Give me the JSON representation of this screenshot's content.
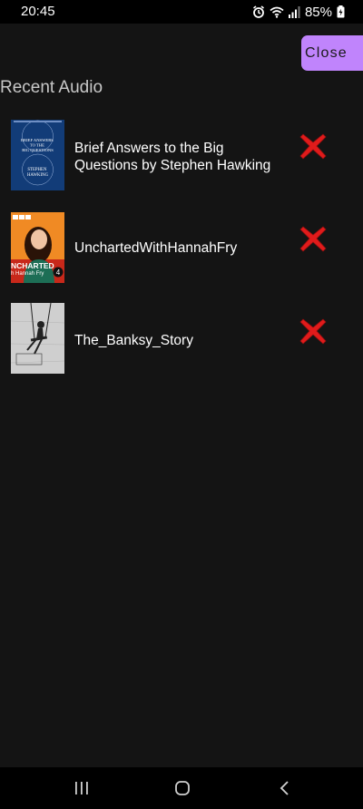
{
  "status_bar": {
    "time": "20:45",
    "battery_percent": "85%",
    "icons": [
      "alarm-icon",
      "wifi-icon",
      "signal-icon",
      "battery-charging-icon"
    ]
  },
  "close_label": "Close",
  "section_title": "Recent Audio",
  "colors": {
    "background": "#141414",
    "close_button": "#c084fc",
    "delete_icon": "#e01b1b"
  },
  "items": [
    {
      "title": "Brief Answers to the Big Questions by Stephen Hawking",
      "cover": {
        "title_text": "BRIEF ANSWERS TO THE BIG QUESTIONS",
        "author_text": "STEPHEN HAWKING"
      },
      "delete_icon": "red-x-icon"
    },
    {
      "title": "UnchartedWithHannahFry",
      "cover": {
        "brand": "BBC",
        "title_text": "NCHARTED",
        "subtitle_text": "h Hannah Fry",
        "badge": "4"
      },
      "delete_icon": "red-x-icon"
    },
    {
      "title": "The_Banksy_Story",
      "cover": {},
      "delete_icon": "red-x-icon"
    }
  ],
  "nav_bar": {
    "icons": [
      "recent-apps-icon",
      "home-icon",
      "back-icon"
    ]
  }
}
